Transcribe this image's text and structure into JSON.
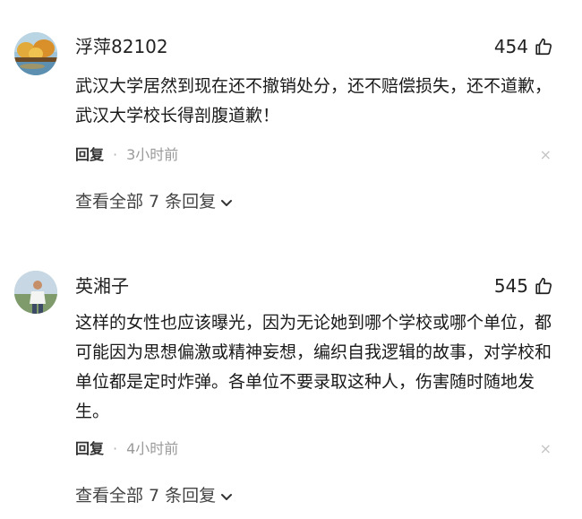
{
  "comments": [
    {
      "username": "浮萍82102",
      "likes": "454",
      "text": "武汉大学居然到现在还不撤销处分，还不赔偿损失，还不道歉，武汉大学校长得剖腹道歉！",
      "reply_label": "回复",
      "separator": "·",
      "time": "3小时前",
      "close_glyph": "×",
      "view_all": "查看全部 7 条回复"
    },
    {
      "username": "英湘子",
      "likes": "545",
      "text": "这样的女性也应该曝光，因为无论她到哪个学校或哪个单位，都可能因为思想偏激或精神妄想，编织自我逻辑的故事，对学校和单位都是定时炸弹。各单位不要录取这种人，伤害随时随地发生。",
      "reply_label": "回复",
      "separator": "·",
      "time": "4小时前",
      "close_glyph": "×",
      "view_all": "查看全部 7 条回复"
    }
  ],
  "icons": {
    "like": "thumbs-up-icon",
    "close": "close-icon",
    "expand": "chevron-down-icon"
  }
}
